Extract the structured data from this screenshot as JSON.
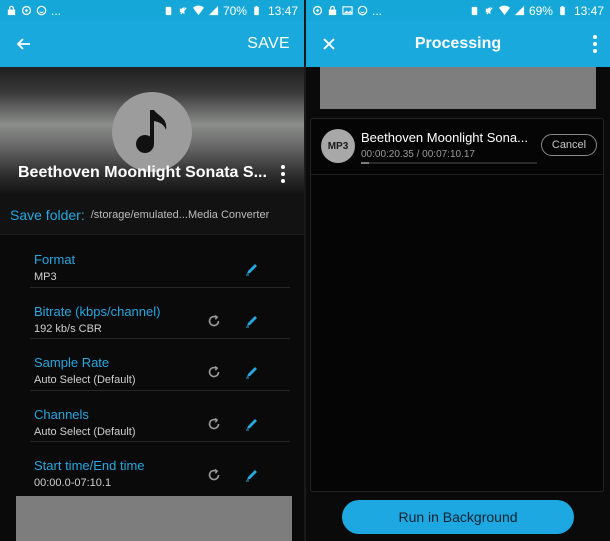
{
  "colors": {
    "primary": "#1aa9dc",
    "accent_text": "#27a8e0",
    "background": "#0a0a0a"
  },
  "left": {
    "status": {
      "battery": "70%",
      "time": "13:47",
      "dots": "..."
    },
    "appbar": {
      "back_icon": "arrow-back-icon",
      "save_label": "SAVE"
    },
    "track": {
      "title": "Beethoven Moonlight Sonata S...",
      "art_icon": "music-note-icon"
    },
    "save_folder": {
      "label": "Save folder:",
      "path": "/storage/emulated...Media Converter"
    },
    "settings": [
      {
        "title": "Format",
        "value": "MP3",
        "resettable": false
      },
      {
        "title": "Bitrate (kbps/channel)",
        "value": "192 kb/s CBR",
        "resettable": true
      },
      {
        "title": "Sample Rate",
        "value": "Auto Select (Default)",
        "resettable": true
      },
      {
        "title": "Channels",
        "value": "Auto Select (Default)",
        "resettable": true
      },
      {
        "title": "Start time/End time",
        "value": "00:00.0-07:10.1",
        "resettable": true
      }
    ]
  },
  "right": {
    "status": {
      "battery": "69%",
      "time": "13:47",
      "dots": "..."
    },
    "appbar": {
      "title": "Processing",
      "close_icon": "close-icon",
      "more_icon": "more-vert-icon"
    },
    "task": {
      "badge": "MP3",
      "name": "Beethoven Moonlight Sona...",
      "elapsed": "00:00:20.35 / 00:07:10.17",
      "progress": 0.047,
      "cancel_label": "Cancel"
    },
    "run_button": "Run in Background"
  }
}
